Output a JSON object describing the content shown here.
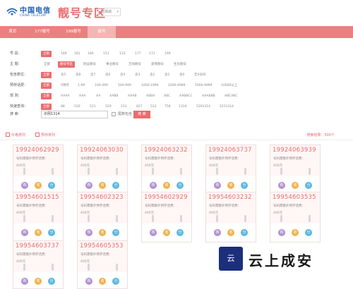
{
  "brand": {
    "logo_cn": "中国电信",
    "logo_en": "CHINA TELECOM",
    "page_title": "靓号专区",
    "city_select": "选择城"
  },
  "nav": {
    "tabs": [
      {
        "label": "首页",
        "active": false
      },
      {
        "label": "177靓号",
        "active": false
      },
      {
        "label": "199靓号",
        "active": false
      },
      {
        "label": "靓号",
        "active": true
      }
    ]
  },
  "filters": {
    "segment": {
      "label": "号 段：",
      "options": [
        "全部",
        "189",
        "181",
        "180",
        "153",
        "133",
        "177",
        "173",
        "199"
      ],
      "selected": 0
    },
    "theme": {
      "label": "主 题：",
      "options": [
        "全部",
        "靓号专区",
        "财运靓号",
        "事业靓号",
        "吉祥靓号",
        "爱情靓号",
        "生肖靓号"
      ],
      "selected": 1
    },
    "contains": {
      "label": "包含数位：",
      "options": [
        "全部",
        "含5",
        "含8",
        "含7",
        "含6",
        "含4",
        "含3",
        "含2",
        "含1",
        "含0",
        "无4号码"
      ],
      "selected": 0
    },
    "deposit": {
      "label": "预存话费：",
      "options": [
        "全部",
        "0预存",
        "1-99",
        "100-499",
        "500-999",
        "1000-1999",
        "2000-4999",
        "5000-9999",
        "10000以上"
      ],
      "selected": 0
    },
    "rule": {
      "label": "规 则：",
      "options": [
        "全部",
        "AAAA",
        "AAA",
        "AA",
        "AABB",
        "AAAB",
        "ABBA",
        "ABC",
        "AABBCC",
        "AAABBB",
        "ABCABC"
      ],
      "selected": 0
    },
    "quick": {
      "label": "快速查询：",
      "options": [
        "全部",
        "88",
        "520",
        "521",
        "520",
        "233",
        "827",
        "512",
        "758",
        "1314",
        "5201314",
        "5211314"
      ],
      "selected": 0
    },
    "search": {
      "label": "搜 索：",
      "value": "示例1314",
      "checkbox_label": "尾数包含",
      "button": "搜 索"
    }
  },
  "sortbar": {
    "sort_deposit": "价格排列",
    "sort_preset": "预存排列",
    "result_count": "搜索结果：500个"
  },
  "cards": [
    {
      "number": "19924062929",
      "note": "号码需额外预存话费：",
      "price": "400元"
    },
    {
      "number": "19924063030",
      "note": "号码需额外预存话费：",
      "price": "400元"
    },
    {
      "number": "19924063232",
      "note": "号码需额外预存话费：",
      "price": "400元"
    },
    {
      "number": "19924063737",
      "note": "号码需额外预存话费：",
      "price": "400元"
    },
    {
      "number": "19924063939",
      "note": "号码需额外预存话费：",
      "price": "400元"
    },
    {
      "number": "19954601515",
      "note": "号码需额外预存话费：",
      "price": "400元"
    },
    {
      "number": "19954602323",
      "note": "号码需额外预存话费：",
      "price": "400元"
    },
    {
      "number": "19954602929",
      "note": "号码需额外预存话费：",
      "price": "400元"
    },
    {
      "number": "19954603232",
      "note": "号码需额外预存话费：",
      "price": "400元"
    },
    {
      "number": "19954603535",
      "note": "号码需额外预存话费：",
      "price": "400元"
    },
    {
      "number": "19954603737",
      "note": "号码需额外预存话费：",
      "price": "400元"
    },
    {
      "number": "19954605353",
      "note": "号码需额外预存话费：",
      "price": "400元"
    }
  ],
  "card_actions": [
    "购",
    "收",
    "分"
  ],
  "watermark": {
    "logo_text": "云",
    "text": "云上成安"
  },
  "colors": {
    "accent": "#ea6c6f",
    "nav_bg": "#ec7f7f",
    "telecom_blue": "#1e5fb8"
  }
}
